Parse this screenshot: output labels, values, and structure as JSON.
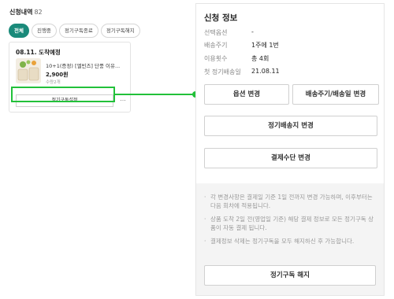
{
  "order_list": {
    "title": "신청내역",
    "count": "82",
    "tabs": [
      "전체",
      "진행중",
      "정기구독종료",
      "정기구독해지"
    ],
    "card": {
      "status": "08.11. 도착예정",
      "product_name": "10+1(증정) [엘빈즈] 단풍 이유...",
      "price": "2,900원",
      "quantity": "수량2개",
      "subscription_button": "정기구독설정",
      "more_button": "..."
    }
  },
  "detail_panel": {
    "title": "신청 정보",
    "rows": [
      {
        "label": "선택옵션",
        "value": "-"
      },
      {
        "label": "배송주기",
        "value": "1주에 1번"
      },
      {
        "label": "이용횟수",
        "value": "총 4회"
      },
      {
        "label": "첫 정기배송일",
        "value": "21.08.11"
      }
    ],
    "buttons": {
      "option_change": "옵션 변경",
      "cycle_change": "배송주기/배송일 변경",
      "address_change": "정기배송지 변경",
      "payment_change": "결제수단 변경",
      "cancel": "정기구독 해지"
    },
    "notes": [
      "각 변경사항은 결제일 기준 1일 전까지 변경 가능하며, 이후부터는 다음 회차에 적용됩니다.",
      "상품 도착 2일 전(영업일 기준) 해당 결제 정보로 모든 정기구독 상품이 자동 결제 됩니다.",
      "결제정보 삭제는 정기구독을 모두 해지하신 후 가능합니다."
    ],
    "note_bullet": "·"
  },
  "colors": {
    "accent_teal": "#1a8a7a",
    "highlight_green": "#22c13a",
    "note_background": "#f4f4f4"
  }
}
